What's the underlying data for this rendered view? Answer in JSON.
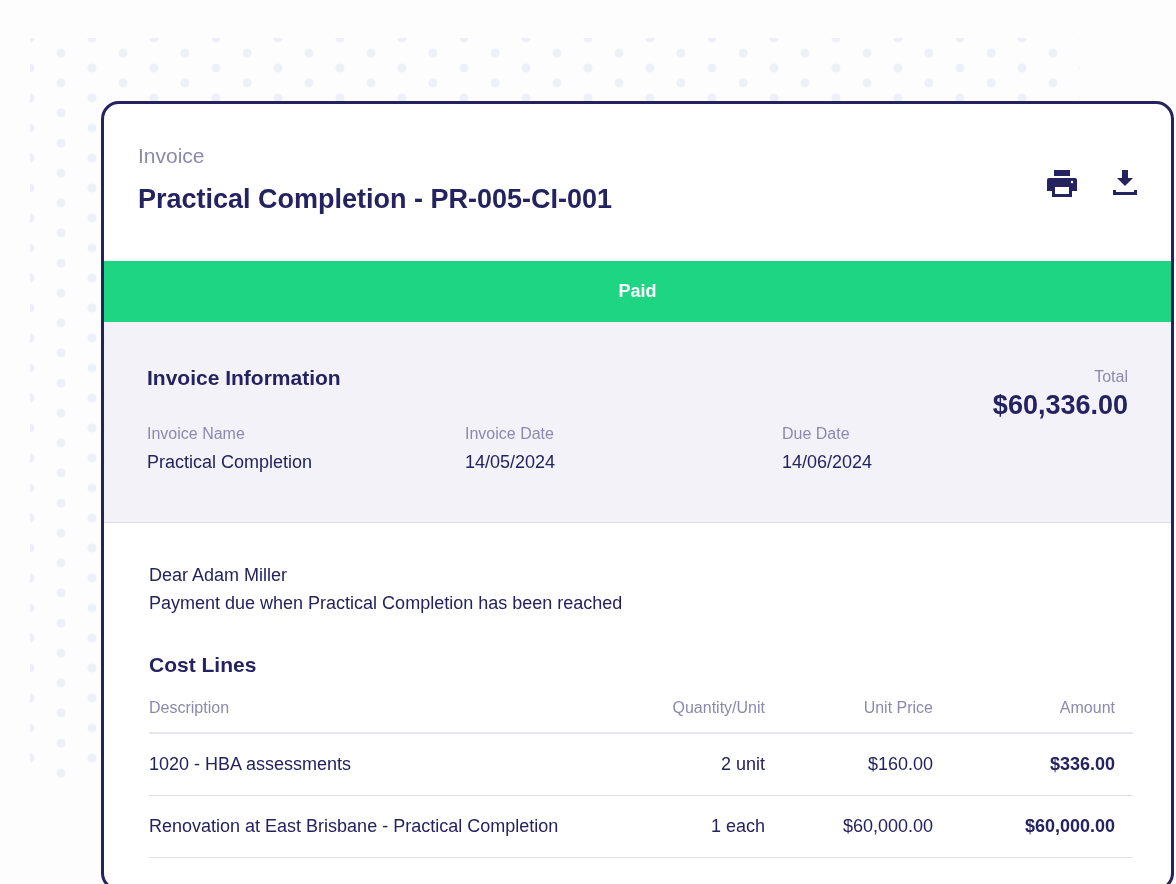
{
  "header": {
    "eyebrow": "Invoice",
    "title": "Practical Completion - PR-005-CI-001"
  },
  "status": {
    "label": "Paid",
    "kind": "paid"
  },
  "info": {
    "heading": "Invoice Information",
    "total_label": "Total",
    "total": "$60,336.00",
    "fields": [
      {
        "label": "Invoice Name",
        "value": "Practical Completion"
      },
      {
        "label": "Invoice Date",
        "value": "14/05/2024"
      },
      {
        "label": "Due Date",
        "value": "14/06/2024"
      }
    ]
  },
  "message": {
    "greeting": "Dear Adam Miller",
    "text": "Payment due when Practical Completion has been reached"
  },
  "cost_lines": {
    "heading": "Cost Lines",
    "columns": [
      "Description",
      "Quantity/Unit",
      "Unit Price",
      "Amount"
    ],
    "rows": [
      {
        "description": "1020 - HBA assessments",
        "quantity": "2 unit",
        "unit_price": "$160.00",
        "amount": "$336.00"
      },
      {
        "description": "Renovation at East Brisbane - Practical Completion",
        "quantity": "1 each",
        "unit_price": "$60,000.00",
        "amount": "$60,000.00"
      }
    ]
  }
}
